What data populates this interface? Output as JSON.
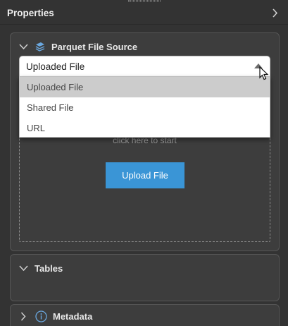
{
  "header": {
    "title": "Properties",
    "chevron_icon": "chevron-right-icon"
  },
  "source_panel": {
    "title": "Parquet File Source",
    "collapse_icon": "chevron-down-icon",
    "source_icon": "parquet-layers-icon",
    "select": {
      "value": "Uploaded File",
      "open": true
    },
    "options": [
      {
        "label": "Uploaded File",
        "selected": true
      },
      {
        "label": "Shared File",
        "selected": false
      },
      {
        "label": "URL",
        "selected": false
      }
    ],
    "dropzone_hint": "click here to start",
    "upload_button": "Upload File"
  },
  "tables_panel": {
    "title": "Tables",
    "collapse_icon": "chevron-down-icon"
  },
  "metadata_panel": {
    "title": "Metadata",
    "expand_icon": "chevron-right-icon",
    "info_icon": "info-icon"
  },
  "colors": {
    "background": "#333333",
    "panel": "#3d3d3d",
    "accent": "#3a95d6",
    "selected_option": "#cccccc"
  }
}
